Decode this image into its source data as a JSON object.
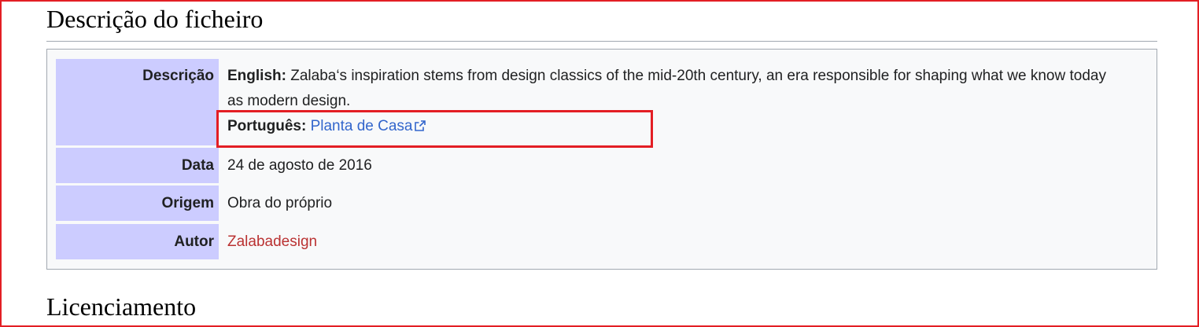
{
  "sections": {
    "description_heading": "Descrição do ficheiro",
    "licensing_heading": "Licenciamento"
  },
  "info": {
    "description": {
      "label": "Descrição",
      "english_lang": "English:",
      "english_text": " Zalaba‘s inspiration stems from design classics of the mid-20th century, an era responsible for shaping what we know today as modern design.",
      "portuguese_lang": "Português:",
      "portuguese_link": "Planta de Casa"
    },
    "date": {
      "label": "Data",
      "value": "24 de agosto de 2016"
    },
    "source": {
      "label": "Origem",
      "value": "Obra do próprio"
    },
    "author": {
      "label": "Autor",
      "value": "Zalabadesign"
    }
  },
  "colors": {
    "label_bg": "#ccccff",
    "box_bg": "#f8f9fa",
    "link_blue": "#3366cc",
    "link_red": "#ba3232",
    "highlight": "#e31e24"
  },
  "icons": {
    "external_link": "external-link-icon"
  }
}
